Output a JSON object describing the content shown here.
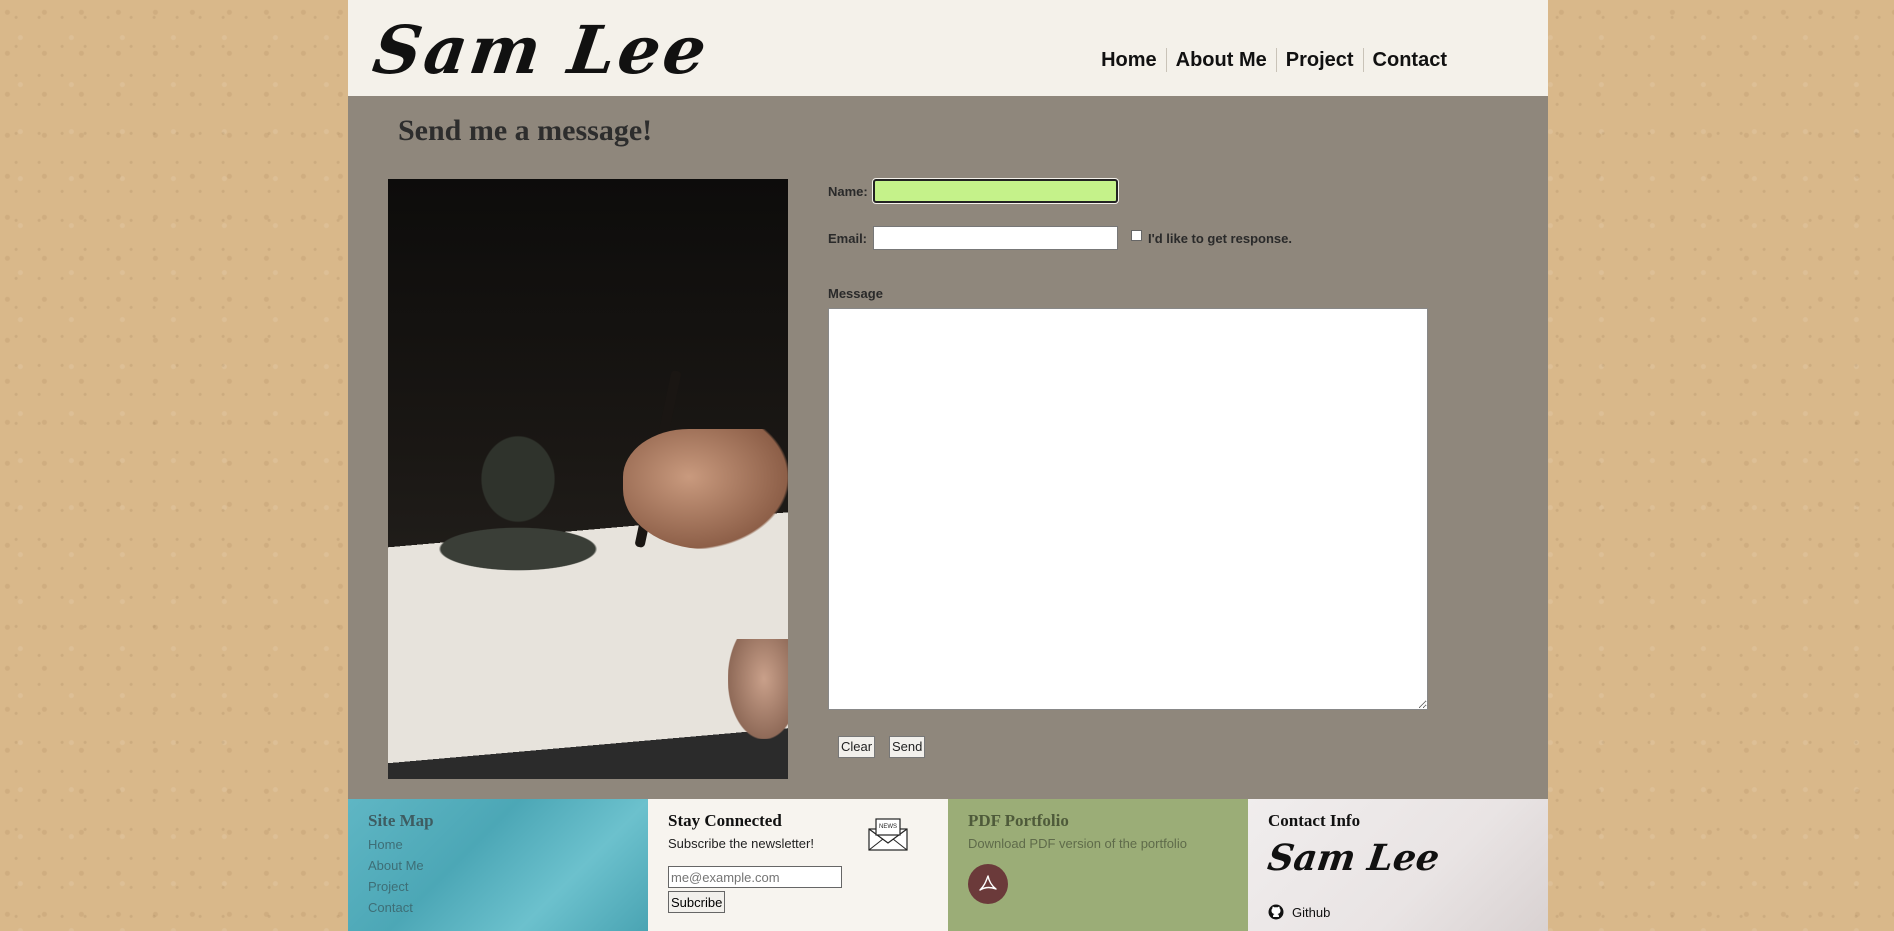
{
  "header": {
    "logo": "Sam Lee",
    "nav": [
      "Home",
      "About Me",
      "Project",
      "Contact"
    ]
  },
  "main": {
    "title": "Send me a message!",
    "name_label": "Name:",
    "email_label": "Email:",
    "checkbox_label": "I'd like to get response.",
    "message_label": "Message",
    "clear_label": "Clear",
    "send_label": "Send"
  },
  "footer": {
    "sitemap": {
      "title": "Site Map",
      "links": [
        "Home",
        "About Me",
        "Project",
        "Contact"
      ]
    },
    "stay_connected": {
      "title": "Stay Connected",
      "text": "Subscribe the newsletter!",
      "icon_text": "NEWS",
      "placeholder": "me@example.com",
      "button": "Subcribe"
    },
    "pdf": {
      "title": "PDF Portfolio",
      "text": "Download PDF version of the portfolio"
    },
    "contact": {
      "title": "Contact Info",
      "logo": "Sam Lee",
      "github": "Github"
    }
  },
  "colors": {
    "name_field_active": "#c5f28a",
    "content_bg": "#8f877c",
    "header_bg": "#f4f1ea"
  }
}
